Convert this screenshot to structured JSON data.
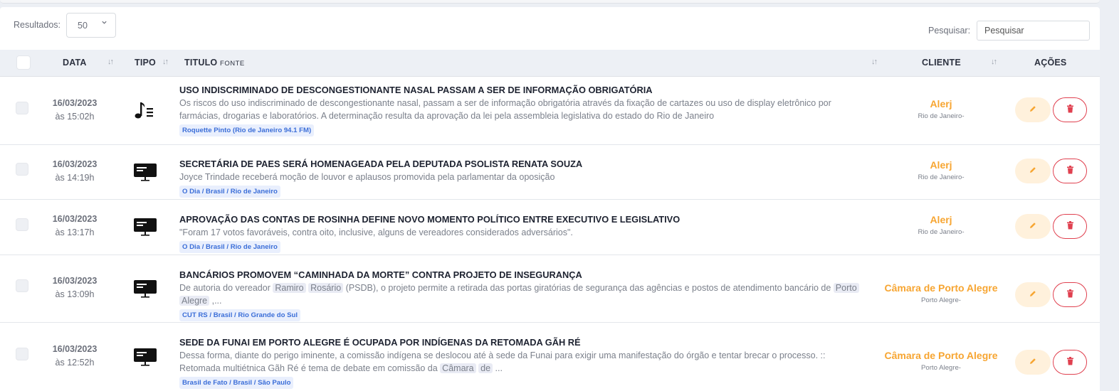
{
  "controls": {
    "results_label": "Resultados:",
    "results_value": "50",
    "search_label": "Pesquisar:",
    "search_placeholder": "Pesquisar"
  },
  "table": {
    "headers": {
      "data": "DATA",
      "tipo": "TIPO",
      "titulo": "TITULO",
      "fonte": "FONTE",
      "cliente": "CLIENTE",
      "acoes": "AÇÕES"
    },
    "rows": [
      {
        "date": "16/03/2023",
        "time": "às 15:02h",
        "type_icon": "radio-icon",
        "title": "USO INDISCRIMINADO DE DESCONGESTIONANTE NASAL PASSAM A SER DE INFORMAÇÃO OBRIGATÓRIA",
        "snippet": "Os riscos do uso indiscriminado de descongestionante nasal, passam a ser de informação obrigatória através da fixação de cartazes ou uso de display eletrônico por farmácias, drogarias e laboratórios. A determinação resulta da aprovação da lei pela assembleia legislativa do estado do Rio de Janeiro",
        "source": "Roquette Pinto (Rio de Janeiro 94.1 FM)",
        "client": "Alerj",
        "location": "Rio de Janeiro-"
      },
      {
        "date": "16/03/2023",
        "time": "às 14:19h",
        "type_icon": "monitor-icon",
        "title": "SECRETÁRIA DE PAES SERÁ HOMENAGEADA PELA DEPUTADA PSOLISTA RENATA SOUZA",
        "snippet": "Joyce Trindade receberá moção de louvor e aplausos promovida pela parlamentar da oposição",
        "source": "O Dia / Brasil / Rio de Janeiro",
        "client": "Alerj",
        "location": "Rio de Janeiro-"
      },
      {
        "date": "16/03/2023",
        "time": "às 13:17h",
        "type_icon": "monitor-icon",
        "title": "APROVAÇÃO DAS CONTAS DE ROSINHA DEFINE NOVO MOMENTO POLÍTICO ENTRE EXECUTIVO E LEGISLATIVO",
        "snippet": "\"Foram 17 votos favoráveis, contra oito, inclusive, alguns de vereadores considerados adversários\".",
        "source": "O Dia / Brasil / Rio de Janeiro",
        "client": "Alerj",
        "location": "Rio de Janeiro-"
      },
      {
        "date": "16/03/2023",
        "time": "às 13:09h",
        "type_icon": "monitor-icon",
        "title": "BANCÁRIOS PROMOVEM “CAMINHADA DA MORTE” CONTRA PROJETO DE INSEGURANÇA",
        "snippet_parts": {
          "p1": "De autoria do vereador ",
          "h1": "Ramiro",
          "h2": "Rosário",
          "p2": " (PSDB), o projeto permite a retirada das portas giratórias de segurança das agências e postos de atendimento bancário de ",
          "h3": "Porto",
          "h4": "Alegre",
          "p3": " ,..."
        },
        "source": "CUT RS / Brasil / Rio Grande do Sul",
        "client": "Câmara de Porto Alegre",
        "location": "Porto Alegre-"
      },
      {
        "date": "16/03/2023",
        "time": "às 12:52h",
        "type_icon": "monitor-icon",
        "title": "SEDE DA FUNAI EM PORTO ALEGRE É OCUPADA POR INDÍGENAS DA RETOMADA GÃH RÉ",
        "snippet_parts": {
          "p1": "Dessa forma, diante do perigo iminente, a comissão indígena se deslocou até à sede da Funai para exigir uma manifestação do órgão e tentar brecar o processo. :: Retomada multiétnica Gãh Ré é tema de debate em comissão da ",
          "h1": "Câmara",
          "h2": "de",
          "p2": " ..."
        },
        "source": "Brasil de Fato / Brasil / São Paulo",
        "client": "Câmara de Porto Alegre",
        "location": "Porto Alegre-"
      }
    ]
  },
  "colors": {
    "client": "#f7a531",
    "source_text": "#3b6ed8",
    "delete": "#e0404f",
    "edit_bg": "#fff1dc",
    "header_bg": "#edf0f5"
  }
}
